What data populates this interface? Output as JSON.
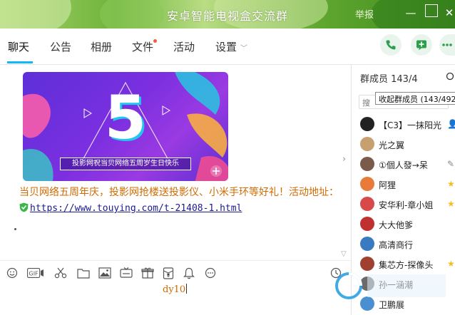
{
  "window": {
    "title": "安卓智能电视盒交流群",
    "report_label": "举报",
    "minimize": "—",
    "close": "✕"
  },
  "tabs": [
    {
      "label": "聊天"
    },
    {
      "label": "公告"
    },
    {
      "label": "相册"
    },
    {
      "label": "文件"
    },
    {
      "label": "活动"
    },
    {
      "label": "设置"
    }
  ],
  "banner": {
    "number": "5",
    "caption": "投影网祝当贝网络五周岁生日快乐"
  },
  "message": {
    "text": "当贝网络五周年庆，投影网抢楼送投影仪、小米手环等好礼！活动地址：",
    "link": "https://www.touying.com/t-21408-1.html"
  },
  "input": {
    "value": "dy10"
  },
  "members_panel": {
    "header": "群成员 143/4",
    "tooltip": "收起群成员 (143/492",
    "search_placeholder": "搜",
    "members": [
      {
        "name": "【C3】一抹阳光",
        "avatar_color": "#222222",
        "badge": "👤",
        "badge_color": "#f0a020"
      },
      {
        "name": "光之翼",
        "avatar_color": "#c8a070",
        "badge": "",
        "badge_color": ""
      },
      {
        "name": "①個人發→呆",
        "avatar_color": "#7a5a4a",
        "badge": "✎",
        "badge_color": "#888888"
      },
      {
        "name": "阿狸",
        "avatar_color": "#e87a3a",
        "badge": "★",
        "badge_color": "#f0c020"
      },
      {
        "name": "安华利-章小姐",
        "avatar_color": "#d84a4a",
        "badge": "★",
        "badge_color": "#f0c020"
      },
      {
        "name": "大大他爹",
        "avatar_color": "#c03030",
        "badge": "",
        "badge_color": ""
      },
      {
        "name": "高清商行",
        "avatar_color": "#3a7ac0",
        "badge": "",
        "badge_color": ""
      },
      {
        "name": "集芯方-探像头",
        "avatar_color": "#a04030",
        "badge": "★",
        "badge_color": "#f0c020"
      },
      {
        "name": "孙一涵潮",
        "avatar_color": "#6a6a6a",
        "badge": "",
        "badge_color": ""
      },
      {
        "name": "卫鹏展",
        "avatar_color": "#4a90d0",
        "badge": "",
        "badge_color": ""
      }
    ]
  },
  "icons": {
    "phone": "phone-icon",
    "add_message": "add-message-icon",
    "more": "more-icon"
  },
  "colors": {
    "accent": "#12b7f5",
    "message_text": "#d16a00",
    "title_bar": "#6fb43c"
  }
}
